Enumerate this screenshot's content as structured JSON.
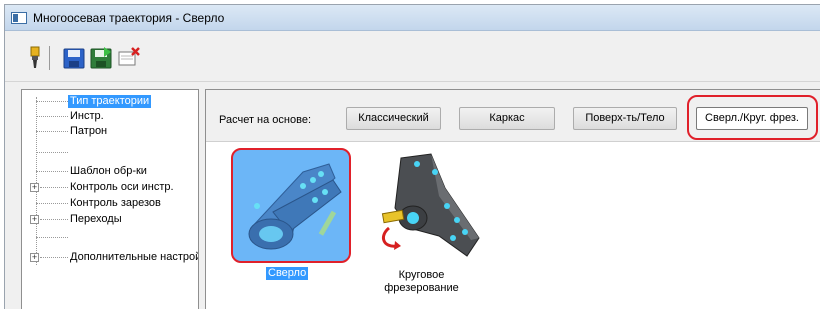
{
  "window": {
    "title": "Многоосевая траектория - Сверло"
  },
  "toolbar": {
    "icons": [
      "drill-tool-icon",
      "save-icon",
      "save-and-run-icon",
      "cancel-icon"
    ]
  },
  "tree": {
    "items": [
      {
        "label": "Тип траектории",
        "selected": true,
        "expandable": false
      },
      {
        "label": "Инстр.",
        "selected": false,
        "expandable": false
      },
      {
        "label": "Патрон",
        "selected": false,
        "expandable": false
      },
      {
        "label": "",
        "selected": false,
        "expandable": false
      },
      {
        "label": "Шаблон обр-ки",
        "selected": false,
        "expandable": false
      },
      {
        "label": "Контроль оси инстр.",
        "selected": false,
        "expandable": true
      },
      {
        "label": "Контроль зарезов",
        "selected": false,
        "expandable": false
      },
      {
        "label": "Переходы",
        "selected": false,
        "expandable": true
      },
      {
        "label": "",
        "selected": false,
        "expandable": false
      },
      {
        "label": "Дополнительные настройки",
        "selected": false,
        "expandable": true
      }
    ]
  },
  "basis": {
    "label": "Расчет на основе:",
    "buttons": [
      "Классический",
      "Каркас",
      "Поверх-ть/Тело",
      "Сверл./Круг. фрез."
    ],
    "active": "Сверл./Круг. фрез."
  },
  "operations": [
    {
      "caption": "Сверло",
      "selected": true
    },
    {
      "caption_line1": "Круговое",
      "caption_line2": "фрезерование",
      "selected": false
    }
  ],
  "colors": {
    "selection": "#3399ff",
    "highlight": "#e0202a",
    "tile_bg": "#6cb6f7"
  }
}
